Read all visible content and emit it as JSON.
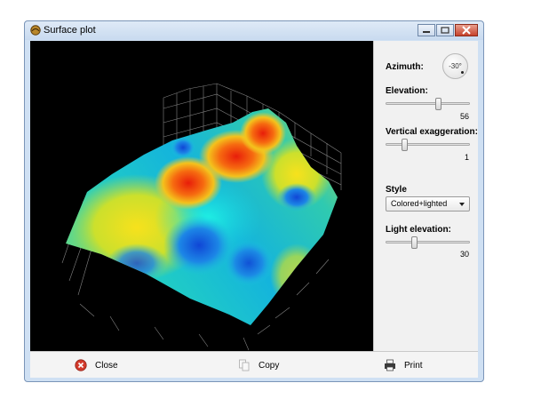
{
  "window": {
    "title": "Surface plot"
  },
  "title_buttons": {
    "minimize": "minimize-icon",
    "maximize": "maximize-icon",
    "close": "close-icon"
  },
  "panel": {
    "azimuth": {
      "label": "Azimuth:",
      "value": "-30°"
    },
    "elevation": {
      "label": "Elevation:",
      "value": "56",
      "fraction": 0.62
    },
    "vertical_exaggeration": {
      "label": "Vertical exaggeration:",
      "value": "1",
      "fraction": 0.22
    },
    "style": {
      "label": "Style",
      "selected": "Colored+lighted"
    },
    "light_elevation": {
      "label": "Light elevation:",
      "value": "30",
      "fraction": 0.34
    }
  },
  "footer": {
    "close_label": "Close",
    "copy_label": "Copy",
    "print_label": "Print"
  },
  "colors": {
    "plot_background": "#000000",
    "close_icon": "#d33a2c",
    "title_bar": "#d6e4f4"
  }
}
